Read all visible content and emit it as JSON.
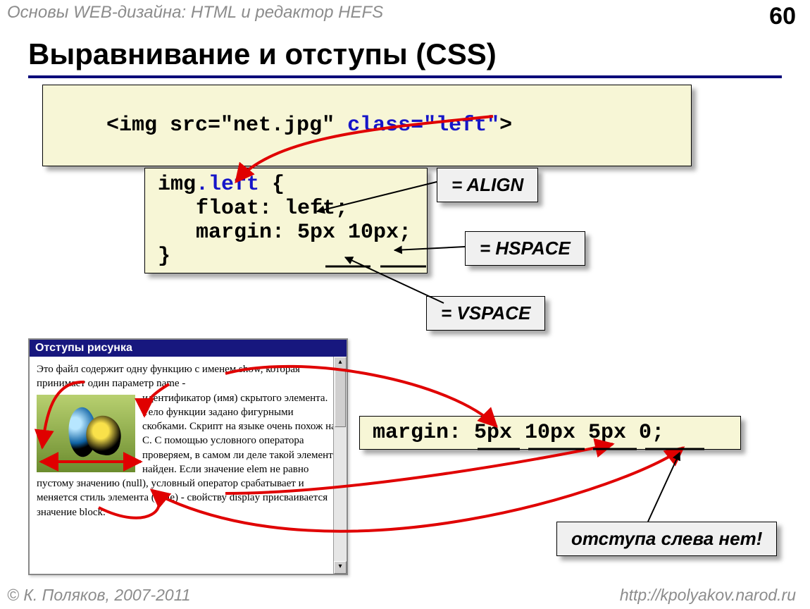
{
  "header": {
    "breadcrumb": "Основы WEB-дизайна: HTML и редактор HEFS",
    "page_number": "60"
  },
  "title": "Выравнивание и отступы (CSS)",
  "code_box_1": {
    "prefix": "<img src=\"net.jpg\" ",
    "attr": "class=\"left\"",
    "suffix": ">"
  },
  "code_box_2": {
    "l1a": "img",
    "l1b": ".left",
    "l1c": " {",
    "l2": "   float: left;",
    "l3": "   margin: 5px 10px;",
    "l4": "}"
  },
  "code_box_3": "margin: 5px 10px 5px 0;",
  "callouts": {
    "align": "= ALIGN",
    "hspace": "= HSPACE",
    "vspace": "= VSPACE",
    "no_left": "отступа слева нет!"
  },
  "preview": {
    "title": "Отступы рисунка",
    "line_top": "Это файл содержит одну функцию с именем show, которая принимает один параметр name -",
    "text": "идентификатор (имя) скрытого элемента. Тело функции задано фигурными скобками. Cкрипт на языке очень похож на С. С помощью условного оператора проверяем, в самом ли деле такой элемент найден. Если значение elem не равно пустому значению (null), условный оператор срабатывает и меняется стиль элемента (style) - свойству display присваивается значение block."
  },
  "footer": {
    "copyright": "© К. Поляков, 2007-2011",
    "url": "http://kpolyakov.narod.ru"
  }
}
